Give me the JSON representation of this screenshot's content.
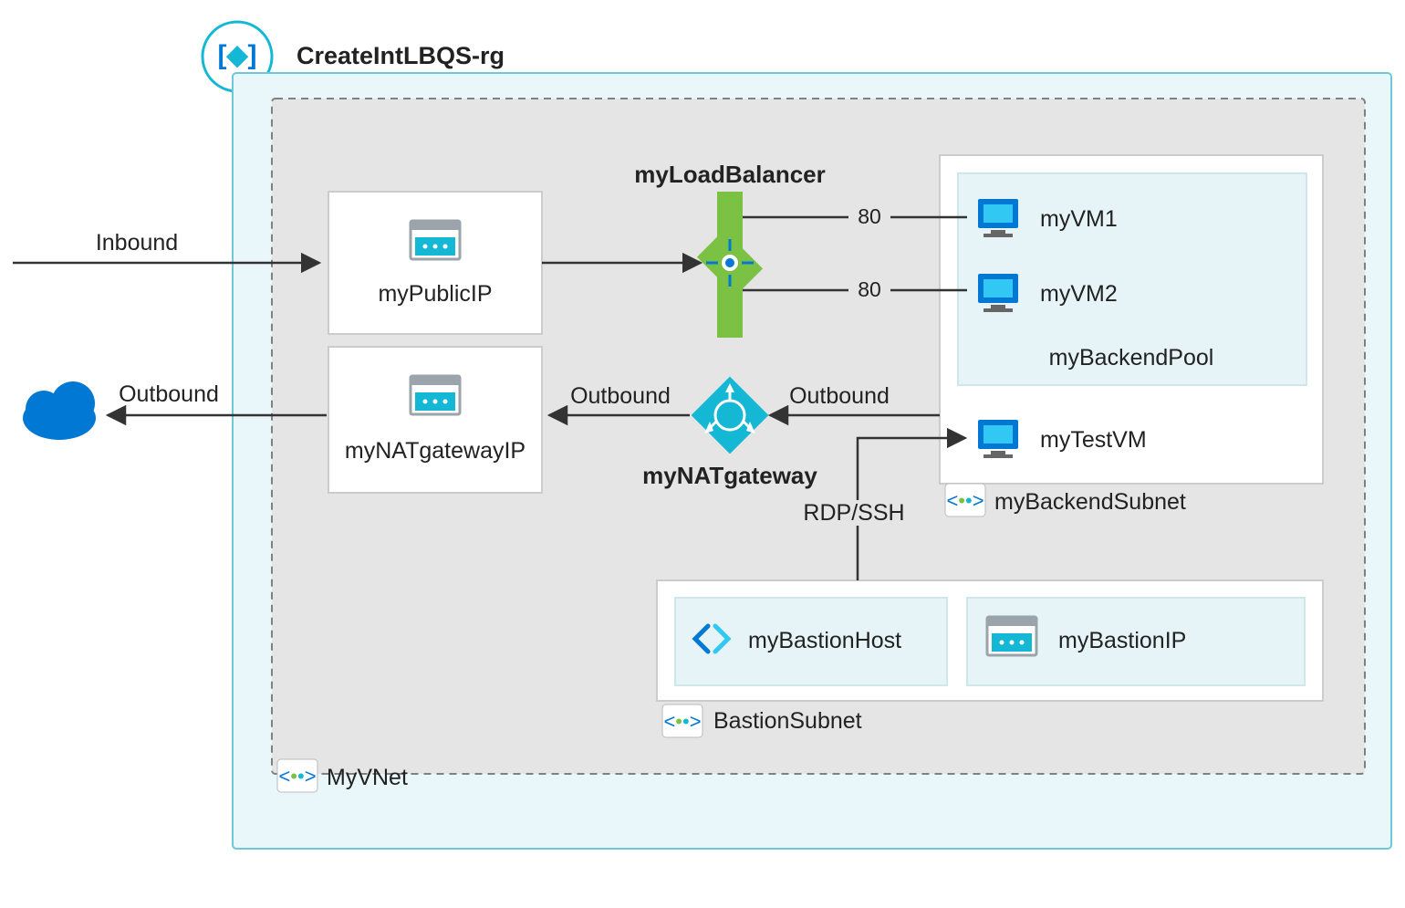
{
  "group": {
    "title": "CreateIntLBQS-rg",
    "vnet_label": "MyVNet"
  },
  "labels": {
    "inbound": "Inbound",
    "outbound": "Outbound",
    "outbound2": "Outbound",
    "outbound3": "Outbound",
    "port80_a": "80",
    "port80_b": "80",
    "rdp_ssh": "RDP/SSH"
  },
  "boxes": {
    "public_ip": "myPublicIP",
    "load_balancer_title": "myLoadBalancer",
    "nat_gateway_ip": "myNATgatewayIP",
    "nat_gateway_title": "myNATgateway",
    "bastion_host": "myBastionHost",
    "bastion_ip": "myBastionIP",
    "bastion_subnet": "BastionSubnet",
    "backend_subnet": "myBackendSubnet",
    "backend_pool": "myBackendPool",
    "vm1": "myVM1",
    "vm2": "myVM2",
    "test_vm": "myTestVM"
  },
  "colors": {
    "accent_teal": "#14B8D4",
    "accent_green": "#7BC143",
    "accent_blue": "#0078D4",
    "gray_box": "#E5E5E5",
    "light_blue_fill": "#E6F4F7",
    "vnet_fill": "#E9F7FA"
  }
}
